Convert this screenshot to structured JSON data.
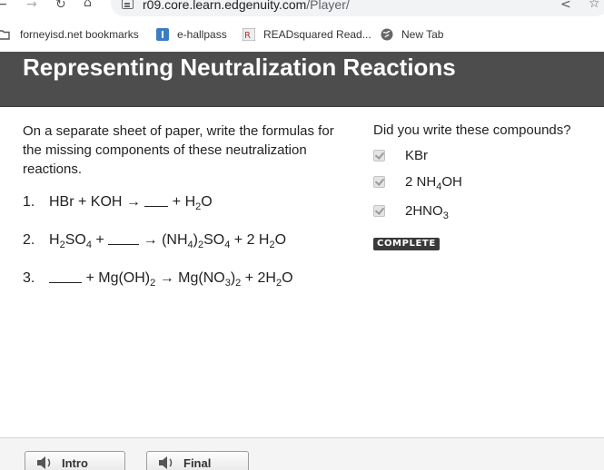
{
  "browser": {
    "url_host": "r09.core.learn.edgenuity.com",
    "url_path": "/Player/",
    "back_icon": "back-arrow-icon",
    "forward_icon": "forward-arrow-icon",
    "reload_icon": "reload-icon",
    "home_icon": "home-icon",
    "share_icon": "share-icon",
    "star_icon": "star-icon"
  },
  "bookmarks": [
    {
      "label": "forneyisd.net bookmarks",
      "icon": "folder-icon"
    },
    {
      "label": "e-hallpass",
      "icon": "hallpass-icon"
    },
    {
      "label": "READsquared Read...",
      "icon": "readsquared-icon"
    },
    {
      "label": "New Tab",
      "icon": "globe-icon"
    }
  ],
  "header": {
    "title": "Representing Neutralization Reactions"
  },
  "main": {
    "instructions": "On a separate sheet of paper, write the formulas for the missing components of these neutralization reactions.",
    "reactions": [
      {
        "number": "1."
      },
      {
        "number": "2."
      },
      {
        "number": "3."
      }
    ]
  },
  "check": {
    "question": "Did you write these compounds?",
    "items": [
      {
        "checked": true
      },
      {
        "checked": true
      },
      {
        "checked": true
      }
    ],
    "status": "COMPLETE"
  },
  "footer": {
    "intro_label": "Intro",
    "final_label": "Final"
  }
}
